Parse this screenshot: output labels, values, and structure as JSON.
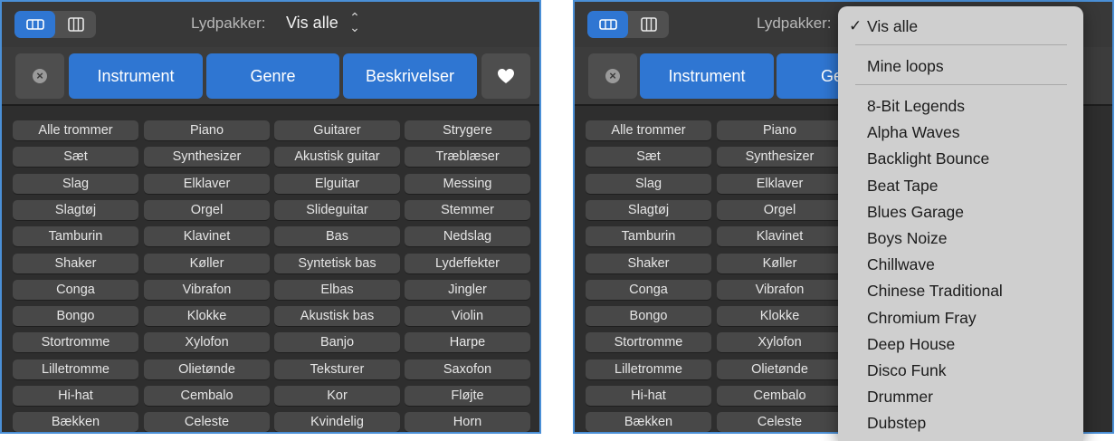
{
  "toolbar": {
    "loop_label": "Lydpakker:",
    "loop_value": "Vis alle",
    "tabs": [
      "Instrument",
      "Genre",
      "Beskrivelser"
    ],
    "right_tab_partial": "Ge"
  },
  "keywords": [
    [
      "Alle trommer",
      "Piano",
      "Guitarer",
      "Strygere"
    ],
    [
      "Sæt",
      "Synthesizer",
      "Akustisk guitar",
      "Træblæser"
    ],
    [
      "Slag",
      "Elklaver",
      "Elguitar",
      "Messing"
    ],
    [
      "Slagtøj",
      "Orgel",
      "Slideguitar",
      "Stemmer"
    ],
    [
      "Tamburin",
      "Klavinet",
      "Bas",
      "Nedslag"
    ],
    [
      "Shaker",
      "Køller",
      "Syntetisk bas",
      "Lydeffekter"
    ],
    [
      "Conga",
      "Vibrafon",
      "Elbas",
      "Jingler"
    ],
    [
      "Bongo",
      "Klokke",
      "Akustisk bas",
      "Violin"
    ],
    [
      "Stortromme",
      "Xylofon",
      "Banjo",
      "Harpe"
    ],
    [
      "Lilletromme",
      "Olietønde",
      "Teksturer",
      "Saxofon"
    ],
    [
      "Hi-hat",
      "Cembalo",
      "Kor",
      "Fløjte"
    ],
    [
      "Bækken",
      "Celeste",
      "Kvindelig",
      "Horn"
    ]
  ],
  "dropdown": {
    "checkmark": "✓",
    "selected": "Vis alle",
    "my_loops": "Mine loops",
    "packs": [
      "8-Bit Legends",
      "Alpha Waves",
      "Backlight Bounce",
      "Beat Tape",
      "Blues Garage",
      "Boys Noize",
      "Chillwave",
      "Chinese Traditional",
      "Chromium Fray",
      "Deep House",
      "Disco Funk",
      "Drummer",
      "Dubstep"
    ]
  },
  "colors": {
    "accent": "#2f76d2",
    "panel_bg": "#2e2e2e",
    "menu_bg": "#cfcfcf"
  },
  "icons": {
    "view_toggle": [
      "button-view-icon",
      "column-view-icon"
    ],
    "reset": "clear-x-icon",
    "favorites": "heart-icon",
    "popup": "chevron-up-down-icon"
  }
}
